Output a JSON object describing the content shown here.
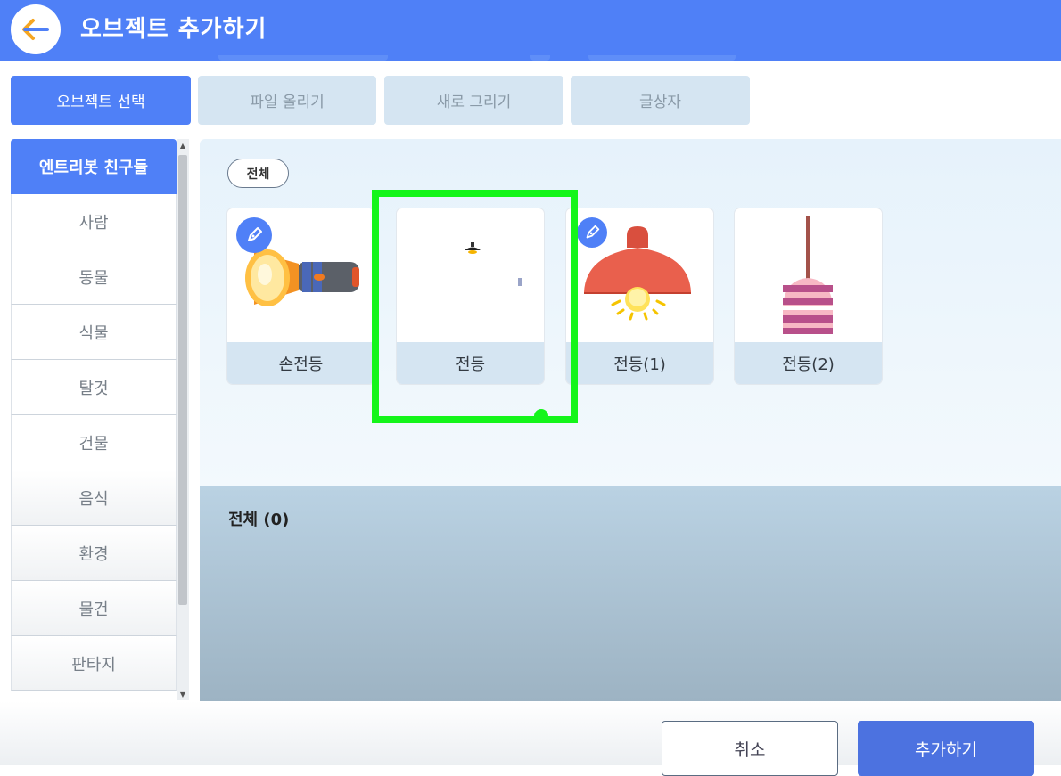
{
  "header": {
    "title": "오브젝트 추가하기",
    "back_icon": "arrow-left-icon",
    "accent_color": "#4f80f7"
  },
  "tabs": [
    {
      "label": "오브젝트 선택",
      "active": true
    },
    {
      "label": "파일 올리기",
      "active": false
    },
    {
      "label": "새로 그리기",
      "active": false
    },
    {
      "label": "글상자",
      "active": false
    }
  ],
  "sidebar": {
    "items": [
      {
        "label": "엔트리봇 친구들",
        "active": true
      },
      {
        "label": "사람"
      },
      {
        "label": "동물"
      },
      {
        "label": "식물"
      },
      {
        "label": "탈것"
      },
      {
        "label": "건물"
      },
      {
        "label": "음식"
      },
      {
        "label": "환경"
      },
      {
        "label": "물건"
      },
      {
        "label": "판타지"
      }
    ]
  },
  "filter": {
    "label": "전체"
  },
  "objects": [
    {
      "label": "손전등",
      "icon": "flashlight-icon",
      "editable": true
    },
    {
      "label": "전등",
      "icon": "small-lamp-icon",
      "editable": false
    },
    {
      "label": "전등(1)",
      "icon": "ceiling-lamp-icon",
      "editable": true
    },
    {
      "label": "전등(2)",
      "icon": "hanging-lamp-icon",
      "editable": false
    }
  ],
  "selected": {
    "title": "전체 (0)"
  },
  "footer": {
    "cancel_label": "취소",
    "add_label": "추가하기"
  },
  "highlight_color": "#14f51a"
}
